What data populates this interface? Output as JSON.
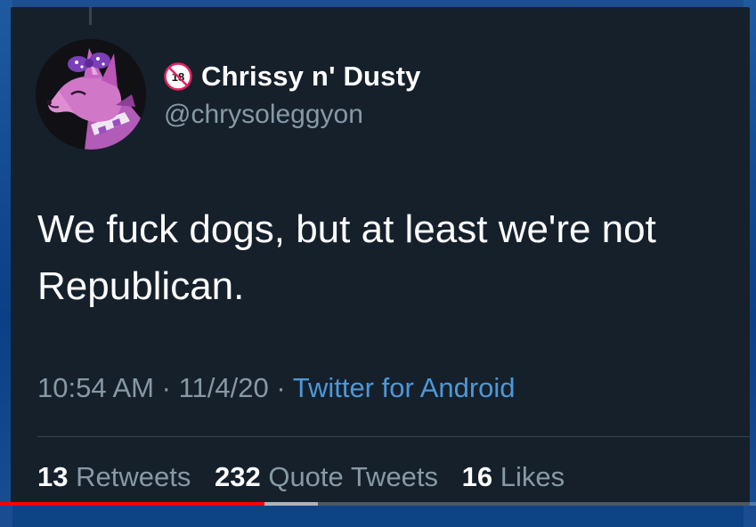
{
  "colors": {
    "card_background": "#15202b",
    "primary_text": "#ffffff",
    "secondary_text": "#8899a6",
    "link": "#4d98d8",
    "progress_played": "#ff0000"
  },
  "tweet": {
    "author": {
      "display_name": "Chrissy n' Dusty",
      "handle": "@chrysoleggyon",
      "badge_icon": "no-under-18-icon",
      "badge_text": "18",
      "avatar_icon": "purple-fursona-dog-avatar"
    },
    "text": "We fuck dogs, but at least we're not Republican.",
    "time": "10:54 AM",
    "date": "11/4/20",
    "separator": "·",
    "source": "Twitter for Android",
    "stats": [
      {
        "count": "13",
        "label": "Retweets"
      },
      {
        "count": "232",
        "label": "Quote Tweets"
      },
      {
        "count": "16",
        "label": "Likes"
      }
    ]
  },
  "video_player": {
    "played_fraction": 0.35,
    "buffered_fraction": 0.42
  }
}
